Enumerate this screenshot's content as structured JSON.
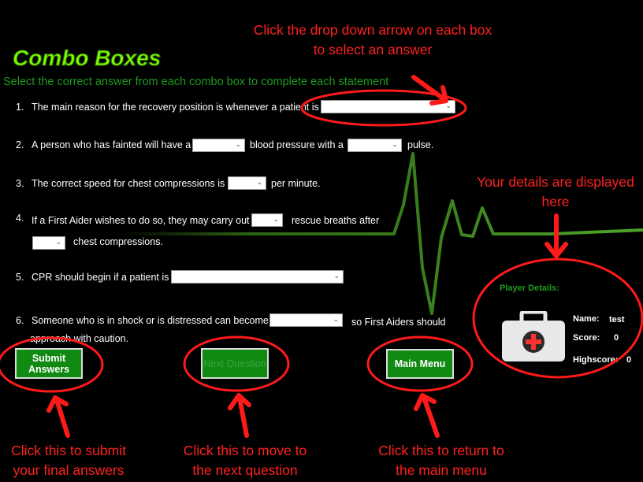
{
  "header": {
    "title": "Combo Boxes",
    "subtitle": "Select the correct answer from each combo box to complete each statement"
  },
  "questions": [
    {
      "num": "1.",
      "text_a": "The main reason for the recovery position is whenever a patient is"
    },
    {
      "num": "2.",
      "text_a": "A person who has fainted will have a",
      "text_b": "blood pressure with a",
      "text_c": "pulse."
    },
    {
      "num": "3.",
      "text_a": "The correct speed for chest compressions is",
      "text_b": "per minute."
    },
    {
      "num": "4.",
      "text_a": "If a First Aider wishes to do so, they may carry out",
      "text_b": "rescue breaths after",
      "text_c": "chest compressions."
    },
    {
      "num": "5.",
      "text_a": "CPR should begin if a patient is"
    },
    {
      "num": "6.",
      "text_a": "Someone who is in shock or is distressed can become",
      "text_b": "so First Aiders should",
      "text_c": "approach with caution."
    }
  ],
  "buttons": {
    "submit": "Submit Answers",
    "next": "Next Question",
    "menu": "Main Menu"
  },
  "player": {
    "heading": "Player Details:",
    "name_label": "Name:",
    "name_value": "test",
    "score_label": "Score:",
    "score_value": "0",
    "highscore_label": "Highscore:",
    "highscore_value": "0"
  },
  "annotations": {
    "dropdown": "Click the drop down arrow on each box to select an answer",
    "details": "Your details are displayed here",
    "submit": "Click this to submit your final answers",
    "next": "Click this to move to the next question",
    "menu": "Click this to return to the main menu"
  },
  "colors": {
    "accent_green": "#118a11",
    "title_green": "#7dfc00",
    "annotation_red": "#ff2020",
    "ecg_green": "#3f8f1a"
  }
}
